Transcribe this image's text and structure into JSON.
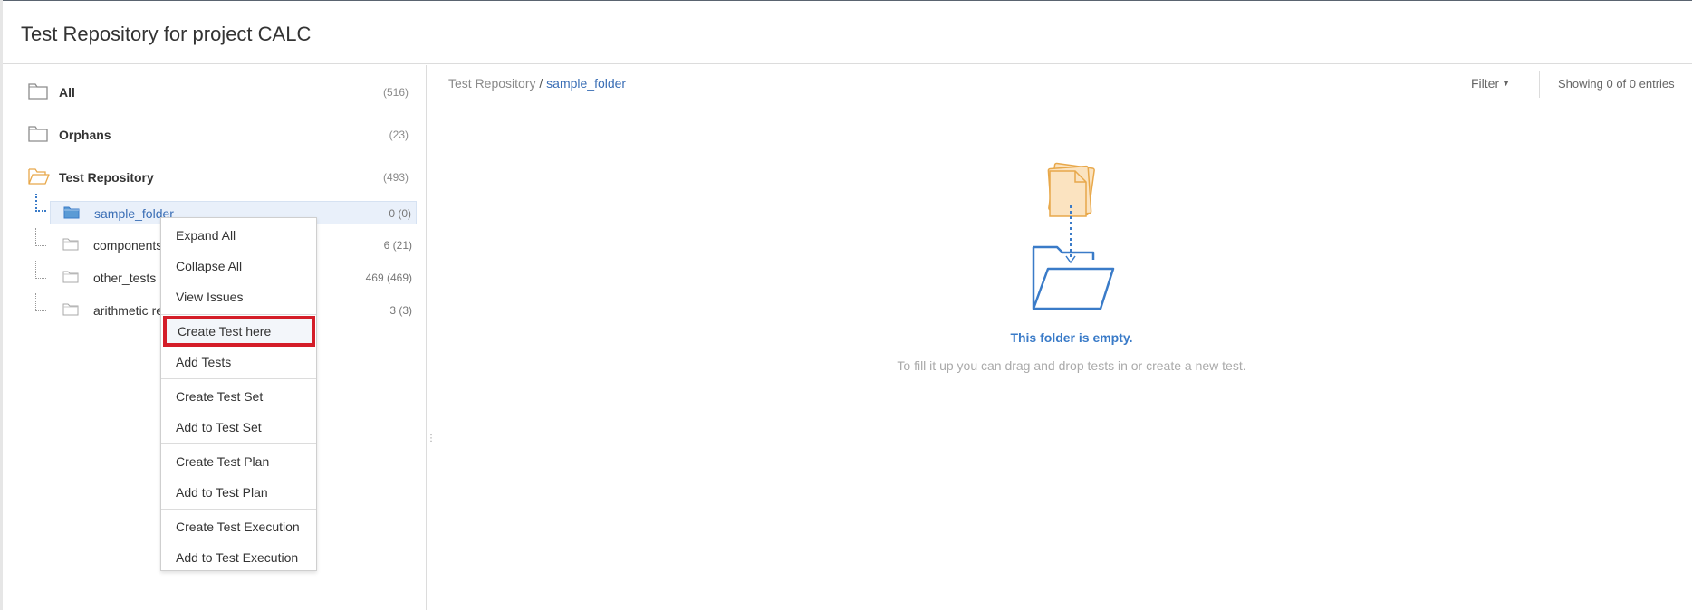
{
  "page": {
    "title": "Test Repository for project CALC"
  },
  "tree": {
    "roots": [
      {
        "label": "All",
        "count": "(516)",
        "icon": "folder-icon",
        "open": false
      },
      {
        "label": "Orphans",
        "count": "(23)",
        "icon": "folder-icon",
        "open": false
      },
      {
        "label": "Test Repository",
        "count": "(493)",
        "icon": "folder-open-icon",
        "open": true
      }
    ],
    "children": [
      {
        "label": "sample_folder",
        "count": "0 (0)",
        "selected": true
      },
      {
        "label": "components",
        "count": "6 (21)",
        "selected": false
      },
      {
        "label": "other_tests",
        "count": "469 (469)",
        "selected": false
      },
      {
        "label": "arithmetic re",
        "count": "3 (3)",
        "selected": false
      }
    ]
  },
  "context_menu": {
    "items": [
      {
        "label": "Expand All"
      },
      {
        "label": "Collapse All"
      },
      {
        "label": "View Issues"
      },
      {
        "label": "Create Test here",
        "highlighted": true
      },
      {
        "label": "Add Tests"
      },
      {
        "label": "Create Test Set"
      },
      {
        "label": "Add to Test Set"
      },
      {
        "label": "Create Test Plan"
      },
      {
        "label": "Add to Test Plan"
      },
      {
        "label": "Create Test Execution"
      },
      {
        "label": "Add to Test Execution"
      }
    ]
  },
  "breadcrumb": {
    "root": "Test Repository",
    "separator": "/",
    "current": "sample_folder"
  },
  "toolbar": {
    "filter_label": "Filter",
    "entries_text": "Showing 0 of 0 entries"
  },
  "empty_state": {
    "title": "This folder is empty.",
    "hint": "To fill it up you can drag and drop tests in or create a new test."
  },
  "colors": {
    "accent": "#3a7bc8",
    "highlight_border": "#d41d28",
    "open_folder": "#e8a84a",
    "selected_row": "#e9f0fa"
  }
}
